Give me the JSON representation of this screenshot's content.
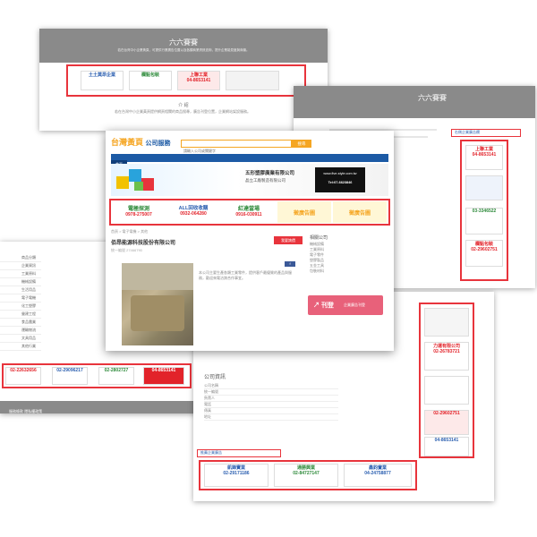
{
  "back_left": {
    "title": "六六賽賽",
    "intro": "若在台灣中小企業黃頁，可提供行業廣告位置以及各類商業資訊查詢，提升企業能見度與商機。",
    "ads": [
      "土土莫昂企業",
      "欄點包裝",
      "上聯工業",
      "04-8653141"
    ],
    "section_title": "介 紹",
    "body_text": "若在台灣中小企業黃頁提供網頁相關的商品搜尋，廣告刊登位置，企業網站架設服務。"
  },
  "back_right": {
    "title": "六六賽賽",
    "side_tag": "右側企業廣告欄",
    "ads": [
      "上聯工業",
      "04-8653141",
      "欄點包裝",
      "02-29602751"
    ],
    "side_ads": [
      "力運有限公司",
      "02-26783721",
      "03-3346522",
      "02-29602751",
      "04-8653141"
    ],
    "bottom_tag": "企業資訊",
    "bottom_ads": [
      "凱鋒寶業",
      "02-29171186",
      "02-84727147",
      "04-24758877"
    ]
  },
  "back_left2": {
    "sidebar": [
      "商品分類",
      "企業資訊",
      "工業原料",
      "機械設備",
      "生活用品",
      "電子電機",
      "化工塑膠",
      "營建工程",
      "食品農業",
      "運輸物流",
      "文具用品",
      "其他行業"
    ],
    "ads": [
      "02-22632656",
      "02-29096217",
      "02-2802727",
      "04-8653141"
    ],
    "footer": "服務條款 隱私權政策"
  },
  "front": {
    "logo": "台灣黃頁",
    "logo_suffix": "公司服務",
    "search_placeholder": "請輸入公司或關鍵字",
    "search_btn": "搜尋",
    "nav": [
      "首頁",
      "公司",
      "產品",
      "新聞",
      "服務"
    ],
    "banner_company": "五形塑膠廣業有限公司",
    "banner_sub": "晶立工廠製造有限公司",
    "banner_phone": "Tel:07-6623846",
    "banner_url": "www.five-style.com.tw",
    "ads": [
      {
        "name": "電極探測",
        "phone": "0978-275007"
      },
      {
        "name": "ALL回收收購",
        "phone": "0932-064280"
      },
      {
        "name": "紅達當場",
        "phone": "0916-030911"
      },
      {
        "name": "徵廣告圖",
        "phone": ""
      },
      {
        "name": "徵廣告圖",
        "phone": ""
      }
    ],
    "breadcrumb": "首頁 > 電子電機 > 其他",
    "company_title": "佰昂能源科技股份有限公司",
    "company_meta": "統一編號 27466790",
    "body_text": "本公司主要生產各類工業零件，提供客戶最優質的產品與服務，歡迎來電洽詢合作事宜。",
    "side_title": "相關公司",
    "side_links": [
      "機械設備",
      "工業原料",
      "電子零件",
      "塑膠製品",
      "五金工具",
      "包裝材料"
    ],
    "action_btn": "↗ 刊登",
    "action_text": "企業廣告刊登",
    "more_btn": "我要詢價"
  },
  "lower": {
    "section": "公司資訊",
    "rows": [
      "公司名稱",
      "統一編號",
      "負責人",
      "電話",
      "傳真",
      "地址"
    ],
    "ads_tag": "推薦企業廣告",
    "ads": [
      {
        "name": "凱鋒寶業",
        "phone": "02-29171186"
      },
      {
        "name": "通勝興業",
        "phone": "02-84727147"
      },
      {
        "name": "鑫鈞實業",
        "phone": "04-24758877"
      }
    ]
  },
  "colors": {
    "accent_red": "#e8343c",
    "header_gray": "#8a8a8a",
    "logo_orange": "#f5a623",
    "nav_blue": "#1c5aa5"
  }
}
